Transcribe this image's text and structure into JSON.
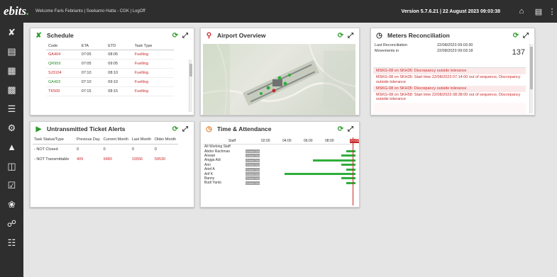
{
  "topbar": {
    "logo_left": "ebits",
    "logo_right": ".",
    "welcome": "Welcome Faris Febrianto | Soekarno Hatta - CGK | LogOff",
    "version": "Version 5.7.6.21  |  22 August 2023 09:03:38"
  },
  "icons": {
    "home": "home-icon",
    "report": "report-icon",
    "menu": "more-icon"
  },
  "sidebar": [
    "flight-icon",
    "document-icon",
    "calendar-icon",
    "chart-icon",
    "list-icon",
    "gear-icon",
    "lock-icon",
    "print-icon",
    "clipboard-icon",
    "globe-icon",
    "network-icon",
    "checklist-icon"
  ],
  "schedule": {
    "title": "Schedule",
    "headers": [
      "Code",
      "ETA",
      "ETD",
      "Task Type"
    ],
    "rows": [
      {
        "code": "GA404",
        "eta": "07:05",
        "etd": "08:05",
        "task": "Fuelling",
        "green": false
      },
      {
        "code": "QR959",
        "eta": "07:05",
        "etd": "09:05",
        "task": "Fuelling",
        "green": true
      },
      {
        "code": "SJ3104",
        "eta": "07:10",
        "etd": "08:10",
        "task": "Fuelling",
        "green": false
      },
      {
        "code": "GA403",
        "eta": "07:10",
        "etd": "09:10",
        "task": "Fuelling",
        "green": true
      },
      {
        "code": "TK509",
        "eta": "07:15",
        "etd": "08:15",
        "task": "Fuelling",
        "green": false
      }
    ]
  },
  "airport": {
    "title": "Airport Overview"
  },
  "meters": {
    "title": "Meters Reconciliation",
    "last_label": "Last Reconciliation",
    "last_value": "22/08/2023 09:03:30",
    "mov_label": "Movements in",
    "mov_value": "22/08/2023 09:03:18",
    "count": "137",
    "alerts": [
      "MSKG-08 on SKH35: Discrepancy outside tolerance",
      "MSKG-08 on SKH35: Start time 22/08/2023 07:14:00 out of sequence, Discrepancy outside tolerance",
      "MSKG-08 on SKH35: Discrepancy outside tolerance",
      "MSKG-08 on SKH58: Start time 22/08/2023 08:38:00 out of sequence, Discrepancy outside tolerance"
    ]
  },
  "alerts": {
    "title": "Untransmitted Ticket Alerts",
    "headers": [
      "Task Status/Type",
      "Previous Day",
      "Current Month",
      "Last Month",
      "Older Month"
    ],
    "rows": [
      {
        "label": "- NOT Closed",
        "prev": "0",
        "cur": "0",
        "last": "0",
        "older": "0",
        "red": false
      },
      {
        "label": "- NOT Transmittable",
        "prev": "409",
        "cur": "9480",
        "last": "15556",
        "older": "59530",
        "red": true
      }
    ]
  },
  "attendance": {
    "title": "Time & Attendance",
    "staff_header": "Staff",
    "times": [
      "02:00",
      "04:00",
      "06:00",
      "08:00",
      "09:03"
    ],
    "check_out": "Check Out",
    "rows": [
      {
        "name": "All Working Staff",
        "bar_start": null,
        "bar_end": null
      },
      {
        "name": "Abdor Rachman",
        "bar_start": 0.9,
        "bar_end": 1.0
      },
      {
        "name": "Anwari",
        "bar_start": 0.85,
        "bar_end": 1.0
      },
      {
        "name": "Angga Adi",
        "bar_start": 0.55,
        "bar_end": 1.0
      },
      {
        "name": "Ario",
        "bar_start": 0.85,
        "bar_end": 1.0
      },
      {
        "name": "Arief A",
        "bar_start": 0.9,
        "bar_end": 1.0
      },
      {
        "name": "Arif K",
        "bar_start": 0.25,
        "bar_end": 1.0
      },
      {
        "name": "Banny",
        "bar_start": 0.85,
        "bar_end": 1.0
      },
      {
        "name": "Budi Yanto",
        "bar_start": 0.9,
        "bar_end": 1.0
      }
    ]
  }
}
